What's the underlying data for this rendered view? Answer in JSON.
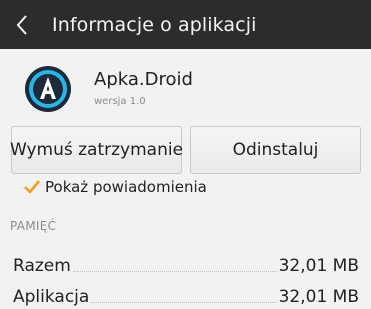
{
  "topbar": {
    "title": "Informacje o aplikacji",
    "back_icon": "chevron-left-icon"
  },
  "app": {
    "name": "Apka.Droid",
    "version": "wersja 1.0",
    "icon": "app-logo-icon",
    "icon_colors": {
      "ring": "#1c2a3a",
      "inner": "#29b6e8",
      "letter": "#ffffff"
    }
  },
  "buttons": {
    "force_stop": "Wymuś zatrzymanie",
    "uninstall": "Odinstaluj"
  },
  "notifications": {
    "label": "Pokaż powiadomienia",
    "checked": true,
    "check_color": "#f0a020"
  },
  "storage": {
    "header": "PAMIĘĆ",
    "rows": [
      {
        "label": "Razem",
        "value": "32,01 MB"
      },
      {
        "label": "Aplikacja",
        "value": "32,01 MB"
      }
    ]
  }
}
